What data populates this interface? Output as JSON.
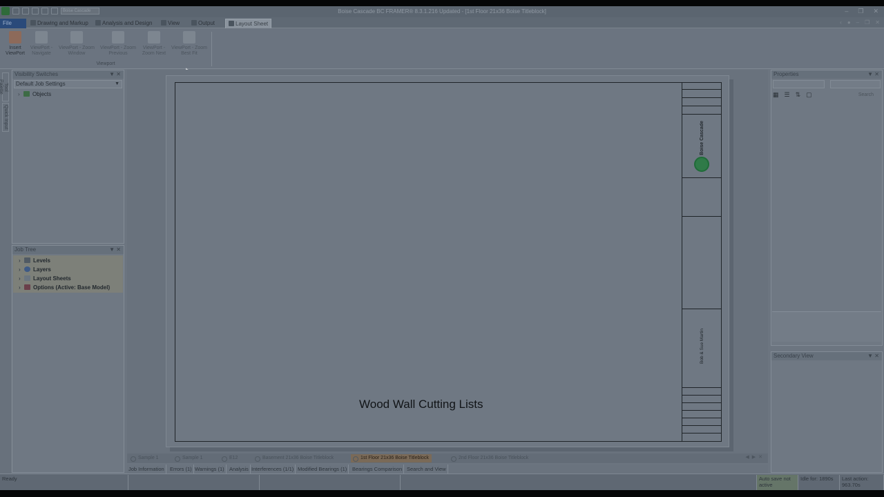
{
  "window": {
    "title": "Boise Cascade BC FRAMER® 8.3.1.216 Updated - [1st Floor 21x36 Boise Titleblock]",
    "quick_access_box": "Boise Cascade"
  },
  "ribbon_tabs": [
    {
      "label": "File"
    },
    {
      "label": "Drawing and Markup"
    },
    {
      "label": "Analysis and Design"
    },
    {
      "label": "View"
    },
    {
      "label": "Output"
    },
    {
      "label": "Layout Sheet"
    }
  ],
  "ribbon": {
    "buttons": [
      {
        "label": "Insert ViewPort"
      },
      {
        "label": "ViewPort - Navigate"
      },
      {
        "label": "ViewPort - Zoom Window"
      },
      {
        "label": "ViewPort - Zoom Previous"
      },
      {
        "label": "ViewPort - Zoom Next"
      },
      {
        "label": "ViewPort - Zoom Best Fit"
      }
    ],
    "group_label": "Viewport"
  },
  "side_strip": {
    "tabs": [
      "Tool Palette",
      "Quick Input"
    ]
  },
  "visibility_panel": {
    "title": "Visibility Switches",
    "dropdown_value": "Default Job Settings",
    "items": [
      {
        "label": "Objects"
      }
    ]
  },
  "job_tree": {
    "title": "Job Tree",
    "items": [
      {
        "label": "Levels"
      },
      {
        "label": "Layers"
      },
      {
        "label": "Layout Sheets"
      },
      {
        "label": "Options (Active: Base Model)"
      }
    ]
  },
  "sheet": {
    "caption": "Wood Wall Cutting Lists",
    "titleblock": {
      "company": "Boise Cascade",
      "client": "Bob & Sue Martin"
    }
  },
  "doc_tabs": [
    {
      "label": "Sample 1"
    },
    {
      "label": "Sample 1"
    },
    {
      "label": "E12"
    },
    {
      "label": "Basement 21x36 Boise Titleblock"
    },
    {
      "label": "1st Floor 21x36 Boise Titleblock"
    },
    {
      "label": "2nd Floor 21x36 Boise Titleblock"
    }
  ],
  "info_tabs": [
    {
      "label": "Job Information"
    },
    {
      "label": "Errors (1)"
    },
    {
      "label": "Warnings (1)"
    },
    {
      "label": "Analysis"
    },
    {
      "label": "Interferences (1/1)"
    },
    {
      "label": "Modified Bearings (1)"
    },
    {
      "label": "Bearings Comparison"
    },
    {
      "label": "Search and View"
    }
  ],
  "properties_panel": {
    "title": "Properties",
    "search_placeholder": "Search"
  },
  "secondary_view": {
    "title": "Secondary View"
  },
  "status_bar": {
    "ready": "Ready",
    "autosave": "Auto save not active",
    "idle": "Idle for: 1890s",
    "last_action": "Last action: 963.70s"
  },
  "colors": {
    "active_doc_tab": "#7a6a58",
    "file_tab": "#2a4a7a",
    "boise_green": "#2f7a48"
  }
}
